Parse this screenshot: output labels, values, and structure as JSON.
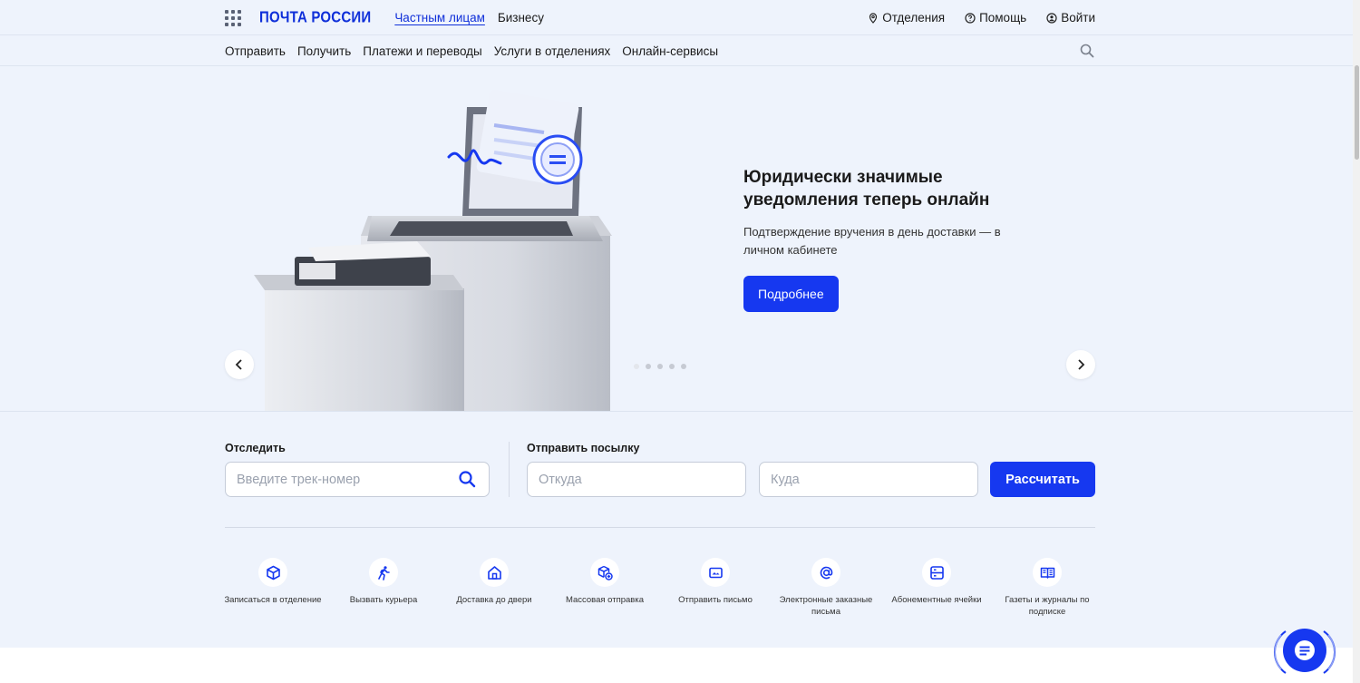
{
  "header": {
    "logo": "ПОЧТА РОССИИ",
    "segments": [
      {
        "label": "Частным лицам",
        "active": true
      },
      {
        "label": "Бизнесу",
        "active": false
      }
    ],
    "right_links": [
      {
        "label": "Отделения",
        "icon": "location-pin-icon"
      },
      {
        "label": "Помощь",
        "icon": "help-circle-icon"
      },
      {
        "label": "Войти",
        "icon": "user-circle-icon"
      }
    ]
  },
  "nav": {
    "items": [
      "Отправить",
      "Получить",
      "Платежи и переводы",
      "Услуги в отделениях",
      "Онлайн-сервисы"
    ]
  },
  "hero": {
    "title": "Юридически значимые уведомления теперь онлайн",
    "subtitle": "Подтверждение вручения в день доставки — в личном кабинете",
    "button": "Подробнее",
    "slides_total": 5,
    "active_slide": 1
  },
  "tracking": {
    "label": "Отследить",
    "placeholder": "Введите трек-номер"
  },
  "send": {
    "label": "Отправить посылку",
    "from_placeholder": "Откуда",
    "to_placeholder": "Куда",
    "button": "Рассчитать"
  },
  "services": [
    {
      "label": "Записаться в отделение",
      "icon": "box-icon"
    },
    {
      "label": "Вызвать курьера",
      "icon": "courier-icon"
    },
    {
      "label": "Доставка до двери",
      "icon": "home-icon"
    },
    {
      "label": "Массовая отправка",
      "icon": "boxes-add-icon"
    },
    {
      "label": "Отправить письмо",
      "icon": "letter-icon"
    },
    {
      "label": "Электронные заказные письма",
      "icon": "at-sign-icon"
    },
    {
      "label": "Абонементные ячейки",
      "icon": "mailbox-icon"
    },
    {
      "label": "Газеты и журналы по подписке",
      "icon": "newspaper-icon"
    }
  ],
  "colors": {
    "brand_blue": "#1638f0",
    "logo_blue": "#0f2fd9",
    "page_background": "#eef3fc"
  }
}
